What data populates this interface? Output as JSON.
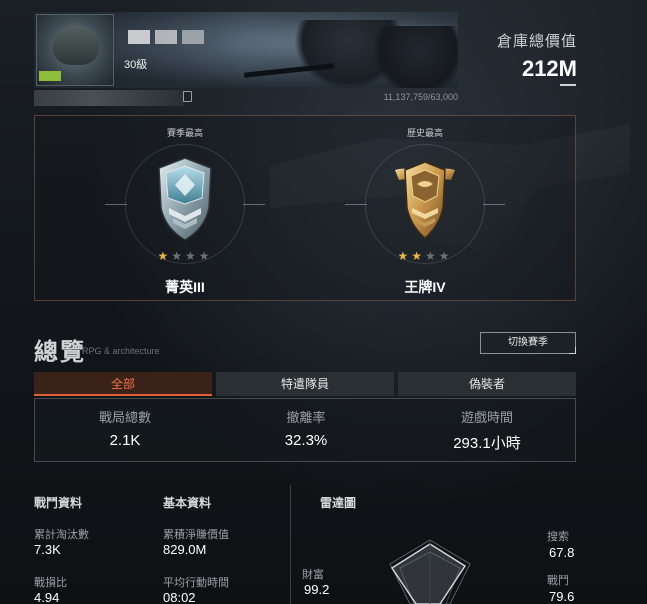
{
  "header": {
    "level": "30級",
    "experience": "11,137,759/63,000",
    "warehouse_label": "倉庫總價值",
    "warehouse_value": "212M"
  },
  "ranks": [
    {
      "caption": "賽季最高",
      "name": "菁英III",
      "stars_filled": 1,
      "stars_total": 4,
      "tier": "silver",
      "icon": "elite-shield-icon"
    },
    {
      "caption": "歷史最高",
      "name": "王牌IV",
      "stars_filled": 2,
      "stars_total": 4,
      "tier": "gold",
      "icon": "ace-winged-shield-icon"
    }
  ],
  "overview": {
    "title": "總覽",
    "subtitle": "RPG & architecture",
    "switch_label": "切換賽季",
    "tabs": [
      "全部",
      "特遣隊員",
      "偽裝者"
    ],
    "active_tab": 0,
    "stats": [
      {
        "label": "戰局總數",
        "value": "2.1K"
      },
      {
        "label": "撤離率",
        "value": "32.3%"
      },
      {
        "label": "遊戲時間",
        "value": "293.1小時"
      }
    ]
  },
  "combat": {
    "title": "戰鬥資料",
    "items": [
      {
        "label": "累計淘汰數",
        "value": "7.3K"
      },
      {
        "label": "戰損比",
        "value": "4.94"
      }
    ]
  },
  "basic": {
    "title": "基本資料",
    "items": [
      {
        "label": "累積淨賺價值",
        "value": "829.0M"
      },
      {
        "label": "平均行動時間",
        "value": "08:02"
      }
    ]
  },
  "radar": {
    "title": "雷達圖",
    "axes": [
      {
        "label": "搜索",
        "value": "67.8"
      },
      {
        "label": "戰鬥",
        "value": "79.6"
      },
      {
        "label": "財富",
        "value": "99.2"
      }
    ]
  }
}
